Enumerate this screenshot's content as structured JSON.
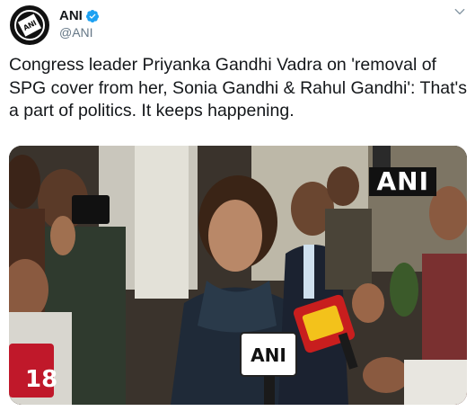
{
  "account": {
    "display_name": "ANI",
    "handle": "@ANI",
    "avatar_text": "ANI"
  },
  "tweet": {
    "text": "Congress leader Priyanka Gandhi Vadra on 'removal of SPG cover from her, Sonia Gandhi & Rahul Gandhi': That's a part of politics. It keeps happening."
  },
  "media": {
    "watermark": "ANI",
    "mic_label": "ANI",
    "channel_logo": "18"
  },
  "colors": {
    "verified": "#1da1f2",
    "text": "#14171a",
    "secondary": "#657786"
  },
  "icons": {
    "verified": "verified-badge-icon",
    "menu": "chevron-down-icon"
  }
}
